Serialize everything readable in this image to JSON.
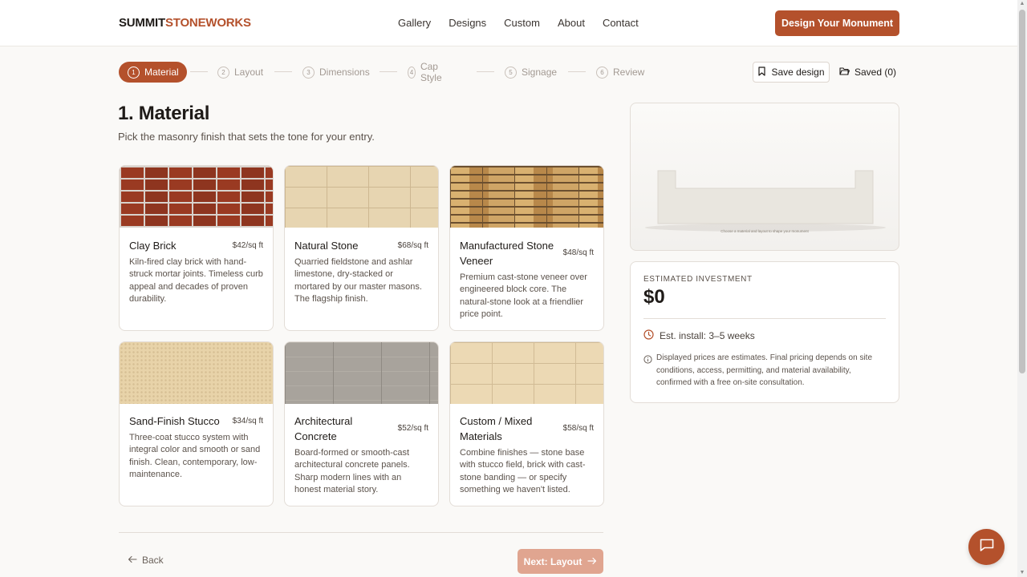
{
  "header": {
    "brand_part1": "SUMMIT",
    "brand_part2": "STONEWORKS",
    "nav": [
      "Gallery",
      "Designs",
      "Custom",
      "About",
      "Contact"
    ],
    "cta_label": "Design Your Monument"
  },
  "stepper": {
    "steps": [
      {
        "num": "1",
        "label": "Material"
      },
      {
        "num": "2",
        "label": "Layout"
      },
      {
        "num": "3",
        "label": "Dimensions"
      },
      {
        "num": "4",
        "label": "Cap Style"
      },
      {
        "num": "5",
        "label": "Signage"
      },
      {
        "num": "6",
        "label": "Review"
      }
    ],
    "active_step": 1,
    "save_label": "Save design",
    "saved_label": "Saved (0)"
  },
  "main": {
    "title": "1. Material",
    "subtitle": "Pick the masonry finish that sets the tone for your entry."
  },
  "materials": [
    {
      "name": "Clay Brick",
      "price": "$42/sq ft",
      "desc": "Kiln-fired clay brick with hand-struck mortar joints. Timeless curb appeal and decades of proven durability."
    },
    {
      "name": "Natural Stone",
      "price": "$68/sq ft",
      "desc": "Quarried fieldstone and ashlar limestone, dry-stacked or mortared by our master masons. The flagship finish."
    },
    {
      "name": "Manufactured Stone Veneer",
      "price": "$48/sq ft",
      "desc": "Premium cast-stone veneer over engineered block core. The natural-stone look at a friendlier price point."
    },
    {
      "name": "Sand-Finish Stucco",
      "price": "$34/sq ft",
      "desc": "Three-coat stucco system with integral color and smooth or sand finish. Clean, contemporary, low-maintenance."
    },
    {
      "name": "Architectural Concrete",
      "price": "$52/sq ft",
      "desc": "Board-formed or smooth-cast architectural concrete panels. Sharp modern lines with an honest material story."
    },
    {
      "name": "Custom / Mixed Materials",
      "price": "$58/sq ft",
      "desc": "Combine finishes — stone base with stucco field, brick with cast-stone banding — or specify something we haven't listed."
    }
  ],
  "preview": {
    "caption": "Choose a material and layout to shape your monument"
  },
  "estimate": {
    "label": "ESTIMATED INVESTMENT",
    "amount": "$0",
    "install": "Est. install: 3–5 weeks",
    "note": "Displayed prices are estimates. Final pricing depends on site conditions, access, permitting, and material availability, confirmed with a free on-site consultation."
  },
  "footer": {
    "back_label": "Back",
    "next_label": "Next: Layout"
  },
  "colors": {
    "accent": "#b4512c",
    "accent_disabled": "#e0a590"
  }
}
